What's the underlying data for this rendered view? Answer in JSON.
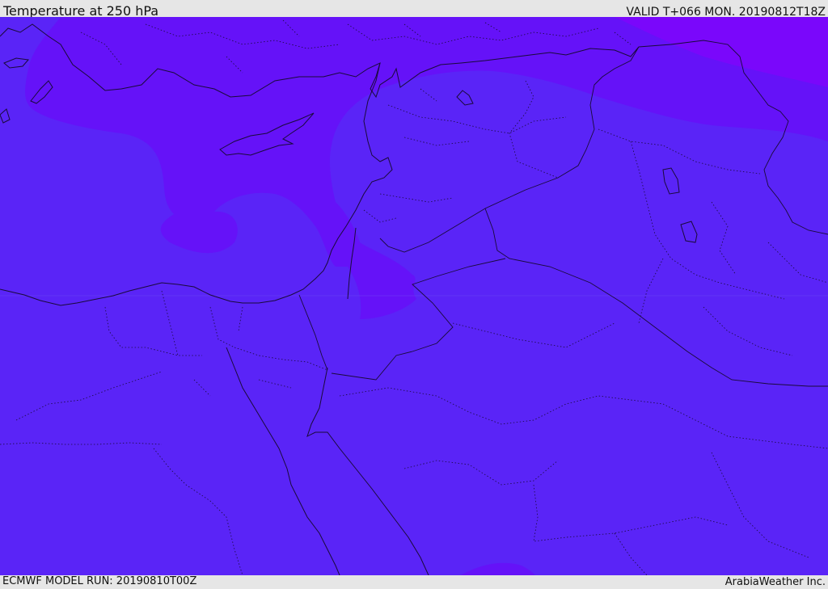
{
  "header": {
    "title": "Temperature at 250 hPa",
    "valid": "VALID T+066 MON. 20190812T18Z"
  },
  "footer": {
    "model_run": "ECMWF MODEL RUN: 20190810T00Z",
    "credit": "ArabiaWeather Inc."
  },
  "map": {
    "colors": {
      "base": "#5a24f7",
      "warm_band": "#6512f8",
      "cold_band": "#7a07fb",
      "lines": "#1a0a3a"
    }
  }
}
